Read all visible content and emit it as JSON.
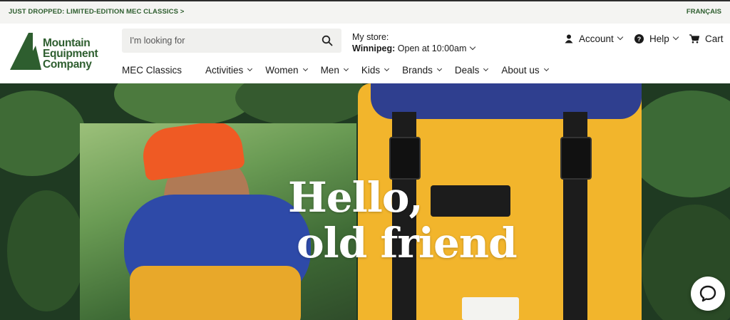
{
  "topbar": {
    "promo": "JUST DROPPED: LIMITED-EDITION MEC CLASSICS >",
    "language": "FRANÇAIS"
  },
  "brand": {
    "line1": "Mountain",
    "line2": "Equipment",
    "line3": "Company",
    "color": "#2e5e2f"
  },
  "search": {
    "placeholder": "I'm looking for",
    "icon": "search-icon"
  },
  "store": {
    "label": "My store:",
    "city": "Winnipeg:",
    "status": "Open at 10:00am"
  },
  "utility": {
    "account": "Account",
    "help": "Help",
    "cart": "Cart"
  },
  "nav": {
    "items": [
      {
        "label": "MEC Classics"
      },
      {
        "label": "Activities"
      },
      {
        "label": "Women"
      },
      {
        "label": "Men"
      },
      {
        "label": "Kids"
      },
      {
        "label": "Brands"
      },
      {
        "label": "Deals"
      },
      {
        "label": "About us"
      }
    ]
  },
  "hero": {
    "headline_line1": "Hello,",
    "headline_line2": "old friend",
    "accent_yellow": "#f2b52c",
    "accent_blue": "#2f3f8f"
  },
  "chat": {
    "icon": "chat-icon"
  }
}
